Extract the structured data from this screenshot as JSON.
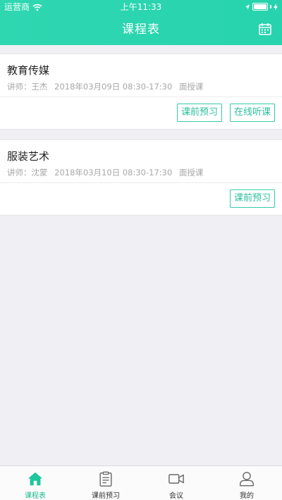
{
  "status_bar": {
    "carrier": "运营商",
    "time": "上午11:33"
  },
  "nav": {
    "title": "课程表",
    "calendar_icon": "calendar-icon"
  },
  "courses": [
    {
      "title": "教育传媒",
      "teacher": "讲师：王杰",
      "datetime": "2018年03月09日 08:30-17:30",
      "mode": "面授课",
      "buttons": [
        "课前预习",
        "在线听课"
      ]
    },
    {
      "title": "服装艺术",
      "teacher": "讲师：沈蒙",
      "datetime": "2018年03月10日 08:30-17:30",
      "mode": "面授课",
      "buttons": [
        "课前预习"
      ]
    }
  ],
  "tabbar": {
    "items": [
      {
        "label": "课程表",
        "icon": "home-icon",
        "active": true
      },
      {
        "label": "课前预习",
        "icon": "clipboard-icon",
        "active": false
      },
      {
        "label": "会议",
        "icon": "video-camera-icon",
        "active": false
      },
      {
        "label": "我的",
        "icon": "user-icon",
        "active": false
      }
    ]
  },
  "colors": {
    "accent": "#27d3ae",
    "button_border": "#36c9a9",
    "active_tab": "#1fb98f",
    "background": "#efeff4"
  }
}
